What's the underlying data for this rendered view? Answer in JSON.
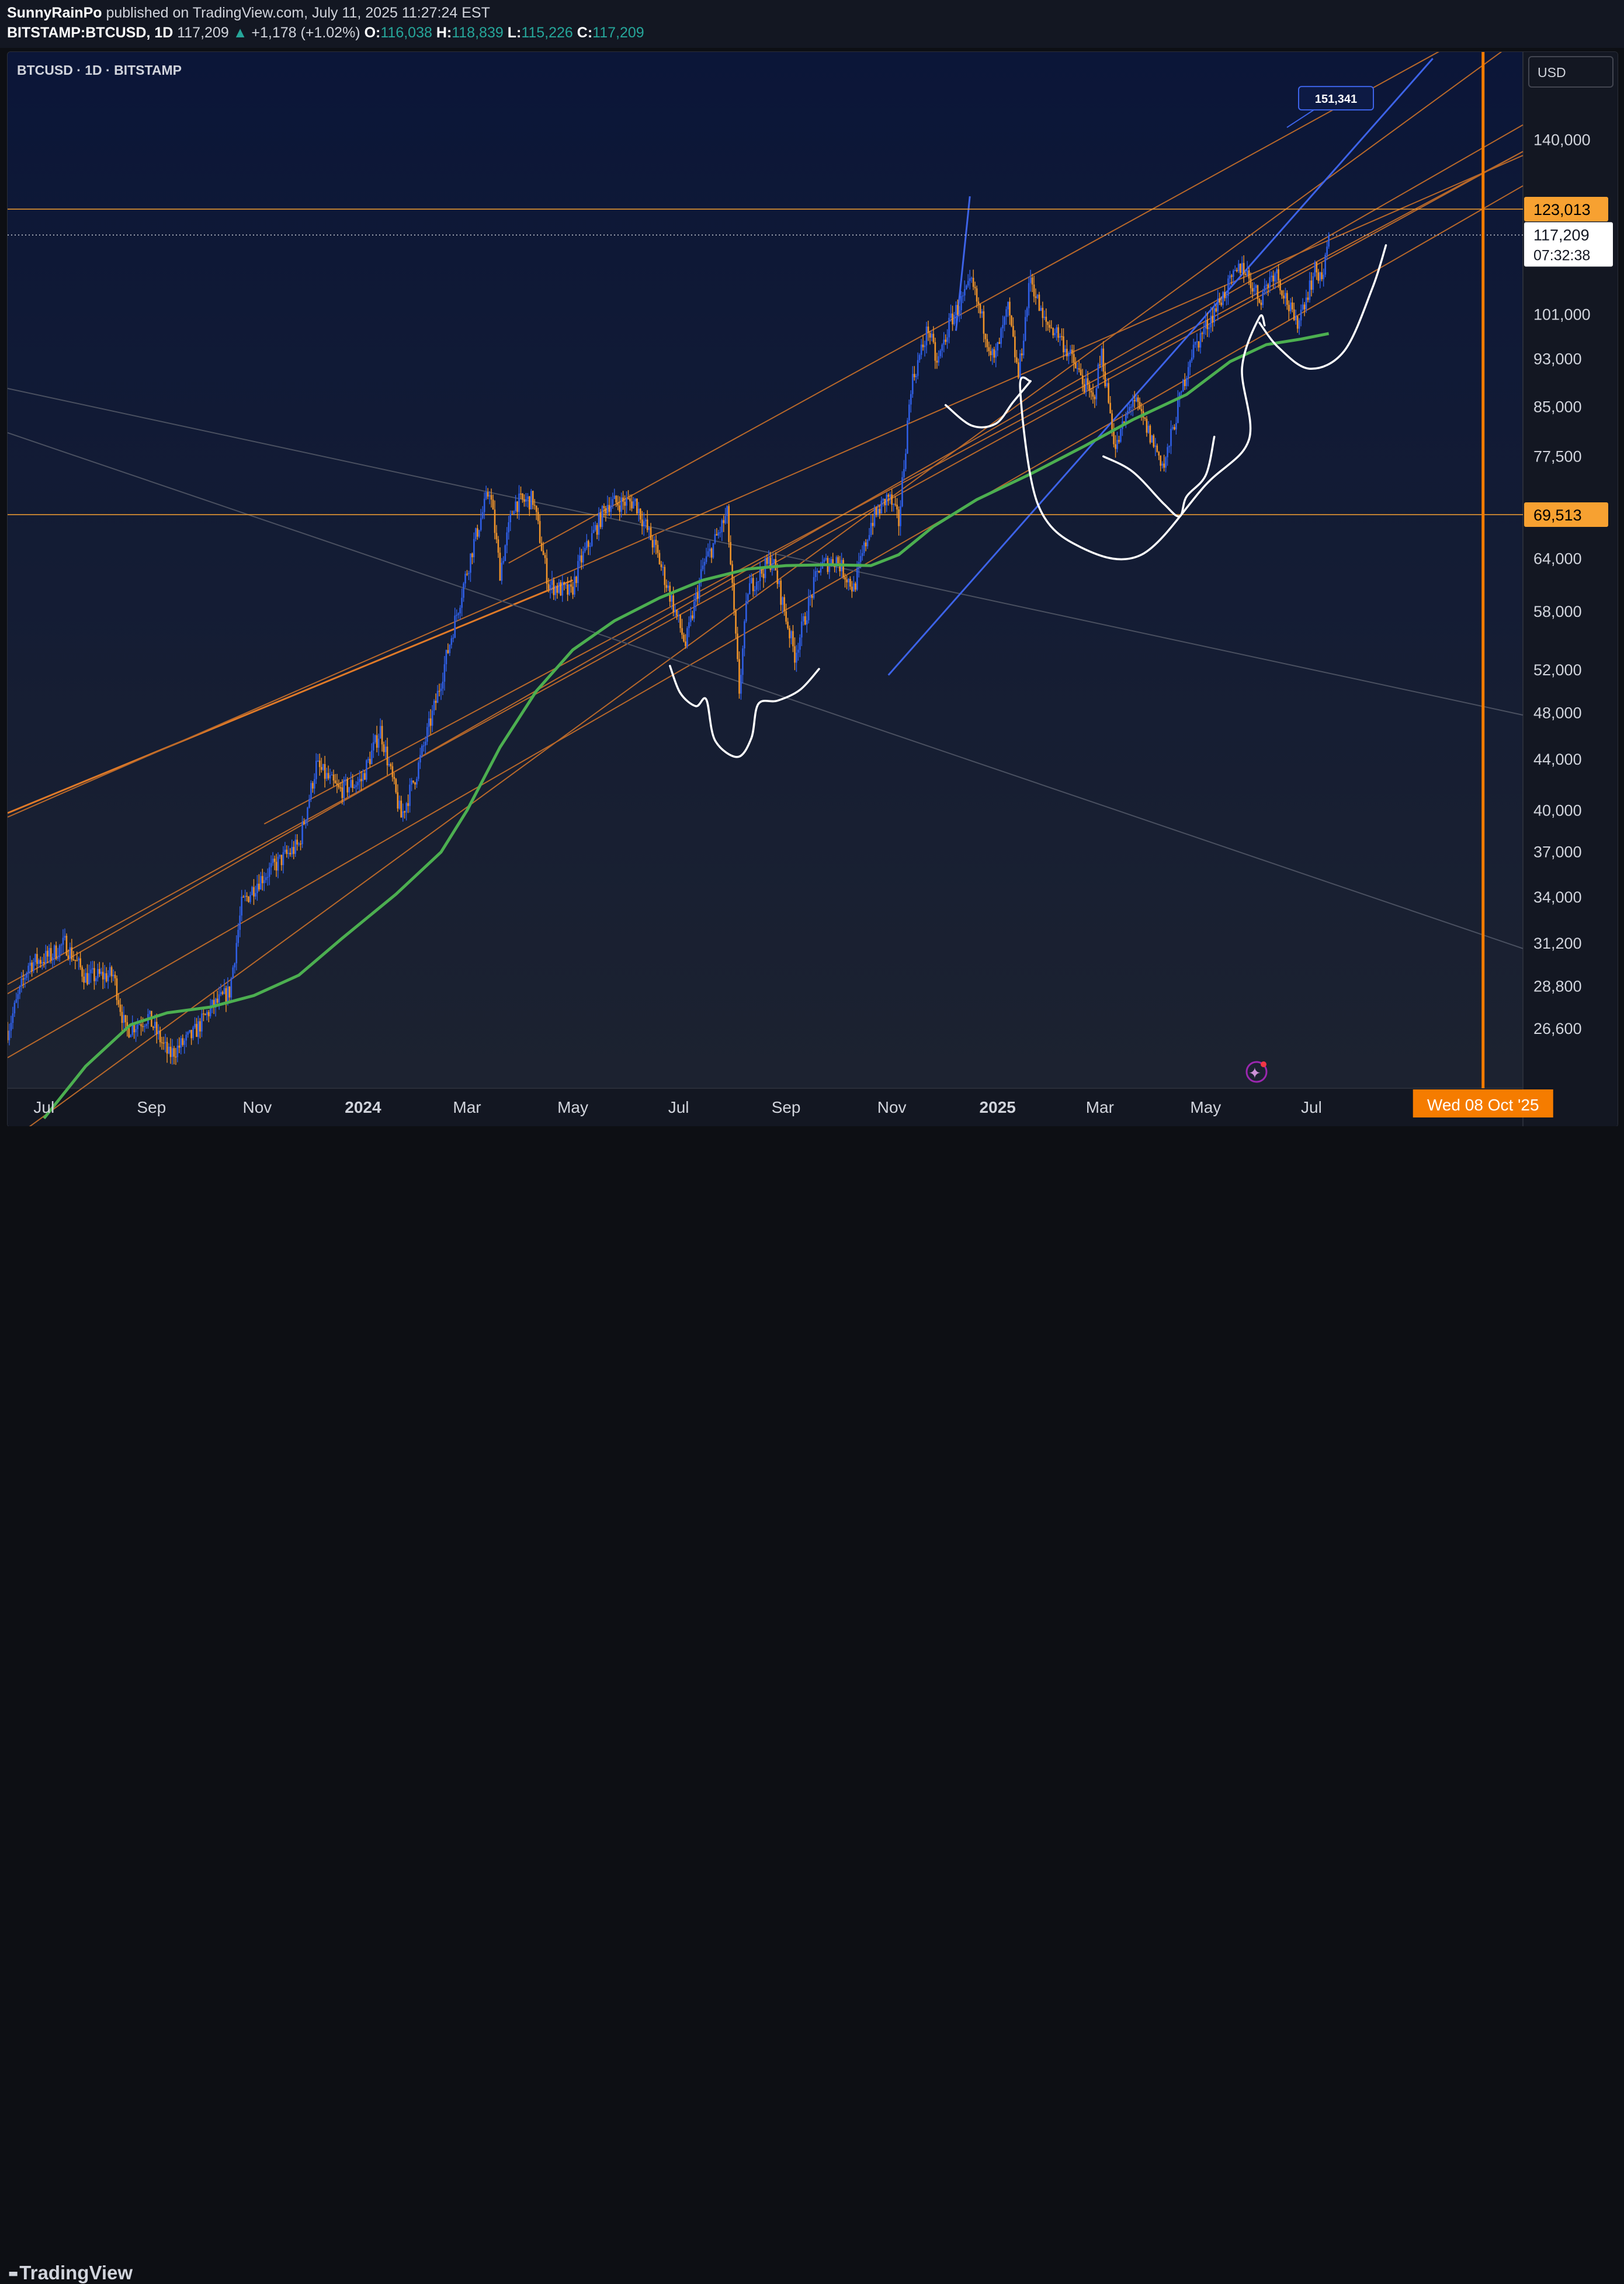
{
  "header": {
    "author": "SunnyRainPo",
    "published_text": "published on TradingView.com, July 11, 2025 11:27:24 EST",
    "symbol_line": "BITSTAMP:BTCUSD, 1D",
    "last": "117,209",
    "change_arrow": "▲",
    "change": "+1,178 (+1.02%)",
    "open_label": "O:",
    "open": "116,038",
    "high_label": "H:",
    "high": "118,839",
    "low_label": "L:",
    "low": "115,226",
    "close_label": "C:",
    "close": "117,209"
  },
  "chart_data": {
    "type": "candlestick",
    "title": "BTCUSD · 1D · BITSTAMP",
    "currency": "USD",
    "scale": "log",
    "ylim": [
      23800,
      165000
    ],
    "x_range": [
      "2023-06-10",
      "2025-10-31"
    ],
    "x_ticks": [
      {
        "date": "2023-07-01",
        "label": "Jul",
        "bold": false
      },
      {
        "date": "2023-09-01",
        "label": "Sep",
        "bold": false
      },
      {
        "date": "2023-11-01",
        "label": "Nov",
        "bold": false
      },
      {
        "date": "2024-01-01",
        "label": "2024",
        "bold": true
      },
      {
        "date": "2024-03-01",
        "label": "Mar",
        "bold": false
      },
      {
        "date": "2024-05-01",
        "label": "May",
        "bold": false
      },
      {
        "date": "2024-07-01",
        "label": "Jul",
        "bold": false
      },
      {
        "date": "2024-09-01",
        "label": "Sep",
        "bold": false
      },
      {
        "date": "2024-11-01",
        "label": "Nov",
        "bold": false
      },
      {
        "date": "2025-01-01",
        "label": "2025",
        "bold": true
      },
      {
        "date": "2025-03-01",
        "label": "Mar",
        "bold": false
      },
      {
        "date": "2025-05-01",
        "label": "May",
        "bold": false
      },
      {
        "date": "2025-07-01",
        "label": "Jul",
        "bold": false
      }
    ],
    "y_ticks": [
      {
        "value": 140000,
        "label": "140,000"
      },
      {
        "value": 101000,
        "label": "101,000"
      },
      {
        "value": 93000,
        "label": "93,000"
      },
      {
        "value": 85000,
        "label": "85,000"
      },
      {
        "value": 77500,
        "label": "77,500"
      },
      {
        "value": 64000,
        "label": "64,000"
      },
      {
        "value": 58000,
        "label": "58,000"
      },
      {
        "value": 52000,
        "label": "52,000"
      },
      {
        "value": 48000,
        "label": "48,000"
      },
      {
        "value": 44000,
        "label": "44,000"
      },
      {
        "value": 40000,
        "label": "40,000"
      },
      {
        "value": 37000,
        "label": "37,000"
      },
      {
        "value": 34000,
        "label": "34,000"
      },
      {
        "value": 31200,
        "label": "31,200"
      },
      {
        "value": 28800,
        "label": "28,800"
      },
      {
        "value": 26600,
        "label": "26,600"
      }
    ],
    "price_path": [
      [
        "2023-06-10",
        26500
      ],
      [
        "2023-06-22",
        30000
      ],
      [
        "2023-07-05",
        30500
      ],
      [
        "2023-07-13",
        31200
      ],
      [
        "2023-07-25",
        29300
      ],
      [
        "2023-08-10",
        29400
      ],
      [
        "2023-08-17",
        26500
      ],
      [
        "2023-08-30",
        27200
      ],
      [
        "2023-09-11",
        25300
      ],
      [
        "2023-09-25",
        26300
      ],
      [
        "2023-10-05",
        27600
      ],
      [
        "2023-10-16",
        28500
      ],
      [
        "2023-10-23",
        33500
      ],
      [
        "2023-11-01",
        35000
      ],
      [
        "2023-11-15",
        36500
      ],
      [
        "2023-11-25",
        37500
      ],
      [
        "2023-12-05",
        43500
      ],
      [
        "2023-12-18",
        41500
      ],
      [
        "2023-12-31",
        42300
      ],
      [
        "2024-01-11",
        46500
      ],
      [
        "2024-01-23",
        39500
      ],
      [
        "2024-02-01",
        43000
      ],
      [
        "2024-02-12",
        49000
      ],
      [
        "2024-02-28",
        61000
      ],
      [
        "2024-03-05",
        66000
      ],
      [
        "2024-03-14",
        73000
      ],
      [
        "2024-03-20",
        62500
      ],
      [
        "2024-03-28",
        71000
      ],
      [
        "2024-04-08",
        71500
      ],
      [
        "2024-04-17",
        61000
      ],
      [
        "2024-04-30",
        60000
      ],
      [
        "2024-05-05",
        63500
      ],
      [
        "2024-05-21",
        71000
      ],
      [
        "2024-06-06",
        71200
      ],
      [
        "2024-06-18",
        65000
      ],
      [
        "2024-06-25",
        60500
      ],
      [
        "2024-07-05",
        54500
      ],
      [
        "2024-07-15",
        63000
      ],
      [
        "2024-07-29",
        69500
      ],
      [
        "2024-08-05",
        50000
      ],
      [
        "2024-08-10",
        60500
      ],
      [
        "2024-08-24",
        64000
      ],
      [
        "2024-09-06",
        53500
      ],
      [
        "2024-09-20",
        63000
      ],
      [
        "2024-09-30",
        64000
      ],
      [
        "2024-10-10",
        60500
      ],
      [
        "2024-10-20",
        68500
      ],
      [
        "2024-10-30",
        72000
      ],
      [
        "2024-11-05",
        68500
      ],
      [
        "2024-11-12",
        88500
      ],
      [
        "2024-11-22",
        98500
      ],
      [
        "2024-11-27",
        92000
      ],
      [
        "2024-12-05",
        100000
      ],
      [
        "2024-12-17",
        107000
      ],
      [
        "2024-12-30",
        92500
      ],
      [
        "2025-01-07",
        102000
      ],
      [
        "2025-01-13",
        90000
      ],
      [
        "2025-01-20",
        108500
      ],
      [
        "2025-01-27",
        100000
      ],
      [
        "2025-02-05",
        97500
      ],
      [
        "2025-02-25",
        86000
      ],
      [
        "2025-03-02",
        94000
      ],
      [
        "2025-03-10",
        78500
      ],
      [
        "2025-03-20",
        86500
      ],
      [
        "2025-04-07",
        76000
      ],
      [
        "2025-04-22",
        93500
      ],
      [
        "2025-05-08",
        103000
      ],
      [
        "2025-05-22",
        111000
      ],
      [
        "2025-06-01",
        104000
      ],
      [
        "2025-06-10",
        110000
      ],
      [
        "2025-06-22",
        99000
      ],
      [
        "2025-07-03",
        109500
      ],
      [
        "2025-07-08",
        108500
      ],
      [
        "2025-07-11",
        117209
      ]
    ],
    "series": [
      {
        "name": "",
        "color": "#4caf50",
        "points": [
          [
            "2023-07-01",
            22500
          ],
          [
            "2023-07-25",
            24800
          ],
          [
            "2023-08-20",
            26800
          ],
          [
            "2023-09-10",
            27400
          ],
          [
            "2023-10-05",
            27700
          ],
          [
            "2023-10-30",
            28300
          ],
          [
            "2023-11-25",
            29400
          ],
          [
            "2023-12-20",
            31500
          ],
          [
            "2024-01-20",
            34200
          ],
          [
            "2024-02-15",
            37000
          ],
          [
            "2024-03-01",
            40000
          ],
          [
            "2024-03-20",
            45000
          ],
          [
            "2024-04-10",
            50000
          ],
          [
            "2024-05-01",
            54000
          ],
          [
            "2024-05-25",
            57000
          ],
          [
            "2024-06-20",
            59500
          ],
          [
            "2024-07-15",
            61500
          ],
          [
            "2024-08-10",
            62800
          ],
          [
            "2024-09-01",
            63200
          ],
          [
            "2024-09-25",
            63300
          ],
          [
            "2024-10-20",
            63200
          ],
          [
            "2024-11-05",
            64500
          ],
          [
            "2024-11-25",
            68000
          ],
          [
            "2024-12-20",
            71500
          ],
          [
            "2025-01-20",
            75000
          ],
          [
            "2025-02-20",
            79000
          ],
          [
            "2025-03-20",
            83000
          ],
          [
            "2025-04-20",
            87000
          ],
          [
            "2025-05-15",
            92500
          ],
          [
            "2025-06-05",
            95500
          ],
          [
            "2025-06-25",
            96500
          ],
          [
            "2025-07-11",
            97500
          ]
        ]
      }
    ],
    "trendlines": [
      {
        "color": "#e07a28",
        "width": 3,
        "p1": [
          "2023-06-10",
          39800
        ],
        "p2": [
          "2024-05-01",
          61500
        ]
      },
      {
        "color": "#b8682a",
        "width": 2,
        "p1": [
          "2023-06-10",
          39500
        ],
        "p2": [
          "2025-10-31",
          136000
        ]
      },
      {
        "color": "#b8682a",
        "width": 2,
        "p1": [
          "2023-06-10",
          28900
        ],
        "p2": [
          "2025-10-31",
          137000
        ]
      },
      {
        "color": "#b8682a",
        "width": 2,
        "p1": [
          "2023-06-10",
          25200
        ],
        "p2": [
          "2025-10-31",
          128500
        ]
      },
      {
        "color": "#b8682a",
        "width": 2,
        "p1": [
          "2023-06-10",
          28400
        ],
        "p2": [
          "2025-10-31",
          144000
        ]
      },
      {
        "color": "#b8682a",
        "width": 2,
        "p1": [
          "2023-06-10",
          21500
        ],
        "p2": [
          "2025-10-31",
          170000
        ]
      },
      {
        "color": "#b8682a",
        "width": 2,
        "p1": [
          "2024-03-25",
          63500
        ],
        "p2": [
          "2025-10-31",
          180000
        ]
      },
      {
        "color": "#b8682a",
        "width": 2,
        "p1": [
          "2023-11-05",
          39000
        ],
        "p2": [
          "2025-10-31",
          137000
        ]
      },
      {
        "color": "#4a5060",
        "width": 2,
        "p1": [
          "2023-06-10",
          88000
        ],
        "p2": [
          "2025-10-31",
          47800
        ]
      },
      {
        "color": "#4a5060",
        "width": 2,
        "p1": [
          "2023-06-10",
          81000
        ],
        "p2": [
          "2025-10-31",
          30900
        ]
      },
      {
        "color": "#3d63e8",
        "width": 3,
        "p1": [
          "2024-10-30",
          51500
        ],
        "p2": [
          "2025-09-09",
          163000
        ]
      },
      {
        "color": "#3d63e8",
        "width": 3,
        "p1": [
          "2024-12-08",
          98000
        ],
        "p2": [
          "2024-12-16",
          126000
        ]
      }
    ],
    "hlines": [
      {
        "value": 123013,
        "label": "123,013",
        "color": "#f7a131"
      },
      {
        "value": 69513,
        "label": "69,513",
        "color": "#f7a131"
      }
    ],
    "last_price": {
      "value": 117209,
      "label": "117,209",
      "countdown": "07:32:38"
    },
    "vline": {
      "date": "2025-10-08",
      "label": "Wed 08 Oct '25",
      "color": "#f57c00"
    },
    "target_label": {
      "value": 151341,
      "label": "151,341"
    },
    "drawings": [
      {
        "points": [
          [
            "2024-06-26",
            52400
          ],
          [
            "2024-07-02",
            49800
          ],
          [
            "2024-07-11",
            48600
          ],
          [
            "2024-07-17",
            49200
          ],
          [
            "2024-07-22",
            45600
          ],
          [
            "2024-08-04",
            44200
          ],
          [
            "2024-08-12",
            45800
          ],
          [
            "2024-08-16",
            48800
          ],
          [
            "2024-08-27",
            49100
          ],
          [
            "2024-09-09",
            50100
          ],
          [
            "2024-09-20",
            52100
          ]
        ]
      },
      {
        "points": [
          [
            "2024-12-02",
            85300
          ],
          [
            "2024-12-17",
            82100
          ],
          [
            "2024-12-31",
            82400
          ],
          [
            "2025-01-10",
            85800
          ],
          [
            "2025-01-20",
            89200
          ]
        ]
      },
      {
        "points": [
          [
            "2025-01-20",
            89200
          ],
          [
            "2025-01-14",
            88000
          ],
          [
            "2025-01-24",
            71000
          ],
          [
            "2025-02-18",
            65400
          ],
          [
            "2025-03-25",
            64500
          ],
          [
            "2025-05-01",
            73500
          ],
          [
            "2025-05-26",
            80000
          ],
          [
            "2025-05-22",
            91500
          ],
          [
            "2025-06-01",
            100500
          ],
          [
            "2025-06-04",
            99000
          ]
        ]
      },
      {
        "points": [
          [
            "2025-03-03",
            77500
          ],
          [
            "2025-03-20",
            75300
          ],
          [
            "2025-04-07",
            70900
          ],
          [
            "2025-04-16",
            69300
          ],
          [
            "2025-04-20",
            71900
          ],
          [
            "2025-05-01",
            74800
          ],
          [
            "2025-05-06",
            80400
          ]
        ]
      },
      {
        "points": [
          [
            "2025-06-01",
            99500
          ],
          [
            "2025-06-12",
            95000
          ],
          [
            "2025-06-30",
            91300
          ],
          [
            "2025-07-20",
            94400
          ],
          [
            "2025-08-05",
            106000
          ],
          [
            "2025-08-13",
            115000
          ]
        ]
      }
    ]
  },
  "footer": {
    "brand": "TradingView"
  }
}
